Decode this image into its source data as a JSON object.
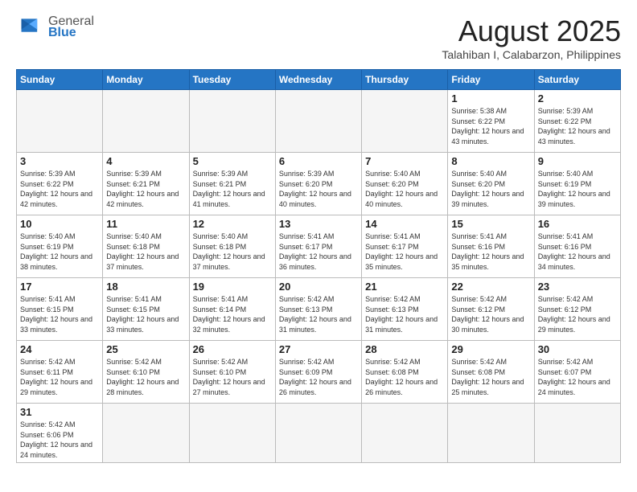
{
  "header": {
    "logo_general": "General",
    "logo_blue": "Blue",
    "title": "August 2025",
    "subtitle": "Talahiban I, Calabarzon, Philippines"
  },
  "days_of_week": [
    "Sunday",
    "Monday",
    "Tuesday",
    "Wednesday",
    "Thursday",
    "Friday",
    "Saturday"
  ],
  "weeks": [
    [
      {
        "day": "",
        "info": ""
      },
      {
        "day": "",
        "info": ""
      },
      {
        "day": "",
        "info": ""
      },
      {
        "day": "",
        "info": ""
      },
      {
        "day": "",
        "info": ""
      },
      {
        "day": "1",
        "info": "Sunrise: 5:38 AM\nSunset: 6:22 PM\nDaylight: 12 hours\nand 43 minutes."
      },
      {
        "day": "2",
        "info": "Sunrise: 5:39 AM\nSunset: 6:22 PM\nDaylight: 12 hours\nand 43 minutes."
      }
    ],
    [
      {
        "day": "3",
        "info": "Sunrise: 5:39 AM\nSunset: 6:22 PM\nDaylight: 12 hours\nand 42 minutes."
      },
      {
        "day": "4",
        "info": "Sunrise: 5:39 AM\nSunset: 6:21 PM\nDaylight: 12 hours\nand 42 minutes."
      },
      {
        "day": "5",
        "info": "Sunrise: 5:39 AM\nSunset: 6:21 PM\nDaylight: 12 hours\nand 41 minutes."
      },
      {
        "day": "6",
        "info": "Sunrise: 5:39 AM\nSunset: 6:20 PM\nDaylight: 12 hours\nand 40 minutes."
      },
      {
        "day": "7",
        "info": "Sunrise: 5:40 AM\nSunset: 6:20 PM\nDaylight: 12 hours\nand 40 minutes."
      },
      {
        "day": "8",
        "info": "Sunrise: 5:40 AM\nSunset: 6:20 PM\nDaylight: 12 hours\nand 39 minutes."
      },
      {
        "day": "9",
        "info": "Sunrise: 5:40 AM\nSunset: 6:19 PM\nDaylight: 12 hours\nand 39 minutes."
      }
    ],
    [
      {
        "day": "10",
        "info": "Sunrise: 5:40 AM\nSunset: 6:19 PM\nDaylight: 12 hours\nand 38 minutes."
      },
      {
        "day": "11",
        "info": "Sunrise: 5:40 AM\nSunset: 6:18 PM\nDaylight: 12 hours\nand 37 minutes."
      },
      {
        "day": "12",
        "info": "Sunrise: 5:40 AM\nSunset: 6:18 PM\nDaylight: 12 hours\nand 37 minutes."
      },
      {
        "day": "13",
        "info": "Sunrise: 5:41 AM\nSunset: 6:17 PM\nDaylight: 12 hours\nand 36 minutes."
      },
      {
        "day": "14",
        "info": "Sunrise: 5:41 AM\nSunset: 6:17 PM\nDaylight: 12 hours\nand 35 minutes."
      },
      {
        "day": "15",
        "info": "Sunrise: 5:41 AM\nSunset: 6:16 PM\nDaylight: 12 hours\nand 35 minutes."
      },
      {
        "day": "16",
        "info": "Sunrise: 5:41 AM\nSunset: 6:16 PM\nDaylight: 12 hours\nand 34 minutes."
      }
    ],
    [
      {
        "day": "17",
        "info": "Sunrise: 5:41 AM\nSunset: 6:15 PM\nDaylight: 12 hours\nand 33 minutes."
      },
      {
        "day": "18",
        "info": "Sunrise: 5:41 AM\nSunset: 6:15 PM\nDaylight: 12 hours\nand 33 minutes."
      },
      {
        "day": "19",
        "info": "Sunrise: 5:41 AM\nSunset: 6:14 PM\nDaylight: 12 hours\nand 32 minutes."
      },
      {
        "day": "20",
        "info": "Sunrise: 5:42 AM\nSunset: 6:13 PM\nDaylight: 12 hours\nand 31 minutes."
      },
      {
        "day": "21",
        "info": "Sunrise: 5:42 AM\nSunset: 6:13 PM\nDaylight: 12 hours\nand 31 minutes."
      },
      {
        "day": "22",
        "info": "Sunrise: 5:42 AM\nSunset: 6:12 PM\nDaylight: 12 hours\nand 30 minutes."
      },
      {
        "day": "23",
        "info": "Sunrise: 5:42 AM\nSunset: 6:12 PM\nDaylight: 12 hours\nand 29 minutes."
      }
    ],
    [
      {
        "day": "24",
        "info": "Sunrise: 5:42 AM\nSunset: 6:11 PM\nDaylight: 12 hours\nand 29 minutes."
      },
      {
        "day": "25",
        "info": "Sunrise: 5:42 AM\nSunset: 6:10 PM\nDaylight: 12 hours\nand 28 minutes."
      },
      {
        "day": "26",
        "info": "Sunrise: 5:42 AM\nSunset: 6:10 PM\nDaylight: 12 hours\nand 27 minutes."
      },
      {
        "day": "27",
        "info": "Sunrise: 5:42 AM\nSunset: 6:09 PM\nDaylight: 12 hours\nand 26 minutes."
      },
      {
        "day": "28",
        "info": "Sunrise: 5:42 AM\nSunset: 6:08 PM\nDaylight: 12 hours\nand 26 minutes."
      },
      {
        "day": "29",
        "info": "Sunrise: 5:42 AM\nSunset: 6:08 PM\nDaylight: 12 hours\nand 25 minutes."
      },
      {
        "day": "30",
        "info": "Sunrise: 5:42 AM\nSunset: 6:07 PM\nDaylight: 12 hours\nand 24 minutes."
      }
    ],
    [
      {
        "day": "31",
        "info": "Sunrise: 5:42 AM\nSunset: 6:06 PM\nDaylight: 12 hours\nand 24 minutes."
      },
      {
        "day": "",
        "info": ""
      },
      {
        "day": "",
        "info": ""
      },
      {
        "day": "",
        "info": ""
      },
      {
        "day": "",
        "info": ""
      },
      {
        "day": "",
        "info": ""
      },
      {
        "day": "",
        "info": ""
      }
    ]
  ]
}
